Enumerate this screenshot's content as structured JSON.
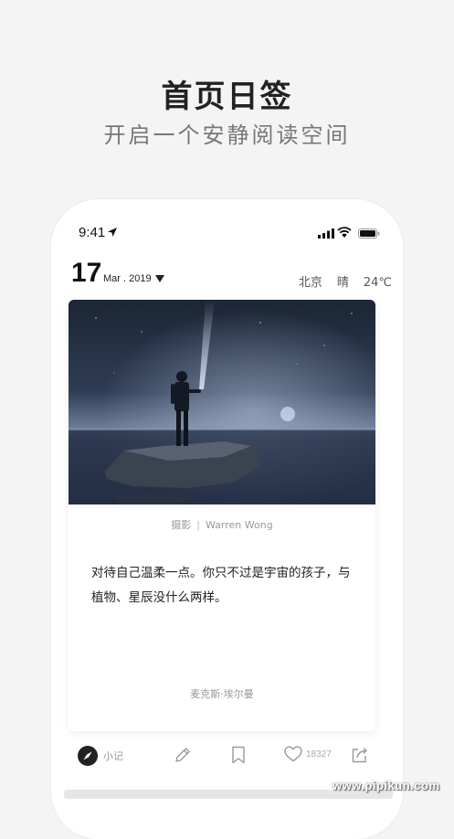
{
  "hero": {
    "title": "首页日签",
    "subtitle": "开启一个安静阅读空间"
  },
  "status_bar": {
    "time": "9:41"
  },
  "date": {
    "day": "17",
    "month_year": "Mar . 2019"
  },
  "weather": {
    "city": "北京",
    "condition": "晴",
    "temperature": "24℃"
  },
  "card": {
    "credit_prefix": "摄影",
    "credit_separator": "|",
    "photographer": "Warren Wong",
    "quote": "对待自己温柔一点。你只不过是宇宙的孩子，与植物、星辰没什么两样。",
    "author": "麦克斯·埃尔曼"
  },
  "toolbar": {
    "note_label": "小记",
    "like_count": "18327"
  },
  "watermark": "www.pipikun.com",
  "colors": {
    "background": "#f4f4f4",
    "card": "#ffffff",
    "text_primary": "#222222",
    "text_secondary": "#999999"
  },
  "icons": [
    "location-arrow-icon",
    "signal-icon",
    "wifi-icon",
    "battery-icon",
    "dropdown-caret-icon",
    "compass-icon",
    "pencil-icon",
    "bookmark-icon",
    "heart-icon",
    "share-icon"
  ]
}
